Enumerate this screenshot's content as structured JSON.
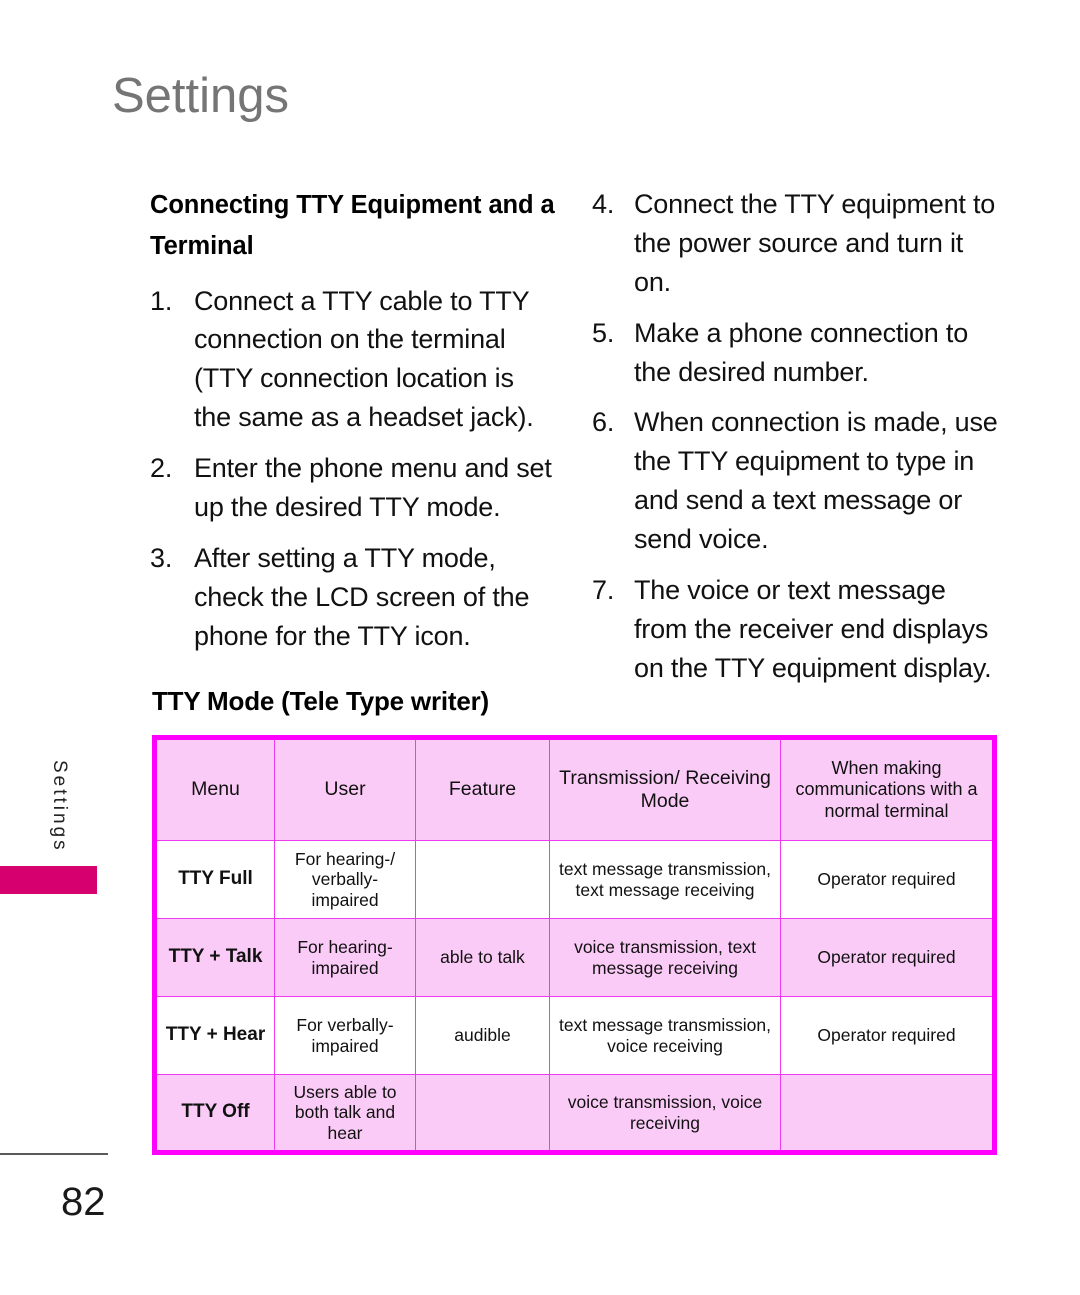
{
  "page": {
    "title": "Settings",
    "side_label": "Settings",
    "number": "82"
  },
  "left_column": {
    "heading": "Connecting TTY Equipment and a Terminal",
    "steps": [
      {
        "num": "1.",
        "text": "Connect a TTY cable to TTY connection on the terminal (TTY connection location is the same as a headset jack)."
      },
      {
        "num": "2.",
        "text": "Enter the phone menu and set up the desired TTY mode."
      },
      {
        "num": "3.",
        "text": "After setting a TTY mode, check the LCD screen of the phone for the TTY icon."
      }
    ]
  },
  "right_column": {
    "steps": [
      {
        "num": "4.",
        "text": "Connect the TTY equipment to the power source and turn it on."
      },
      {
        "num": "5.",
        "text": "Make a phone connection to the desired number."
      },
      {
        "num": "6.",
        "text": "When connection is made, use the TTY equipment to type in and send a text message or send voice."
      },
      {
        "num": "7.",
        "text": "The voice or text message from the receiver end displays on the TTY equipment display."
      }
    ]
  },
  "tty_table": {
    "heading": "TTY Mode (Tele Type writer)",
    "colors": {
      "border": "#ff00ff",
      "inner_border": "#ee3bee",
      "shade": "#fbcbf7",
      "tab": "#d6006e",
      "title": "#757575"
    },
    "columns": [
      "Menu",
      "User",
      "Feature",
      "Transmission/ Receiving Mode",
      "When making communications with a normal terminal"
    ],
    "rows": [
      {
        "shade": false,
        "menu": "TTY Full",
        "user": "For hearing-/ verbally- impaired",
        "feature": "",
        "mode": "text message transmission, text message receiving",
        "normal": "Operator required"
      },
      {
        "shade": true,
        "menu": "TTY + Talk",
        "user": "For hearing- impaired",
        "feature": "able to talk",
        "mode": "voice transmission, text message receiving",
        "normal": "Operator required"
      },
      {
        "shade": false,
        "menu": "TTY + Hear",
        "user": "For verbally- impaired",
        "feature": "audible",
        "mode": "text message transmission, voice receiving",
        "normal": "Operator required"
      },
      {
        "shade": true,
        "menu": "TTY Off",
        "user": "Users able to both talk and hear",
        "feature": "",
        "mode": "voice transmission, voice receiving",
        "normal": ""
      }
    ]
  }
}
